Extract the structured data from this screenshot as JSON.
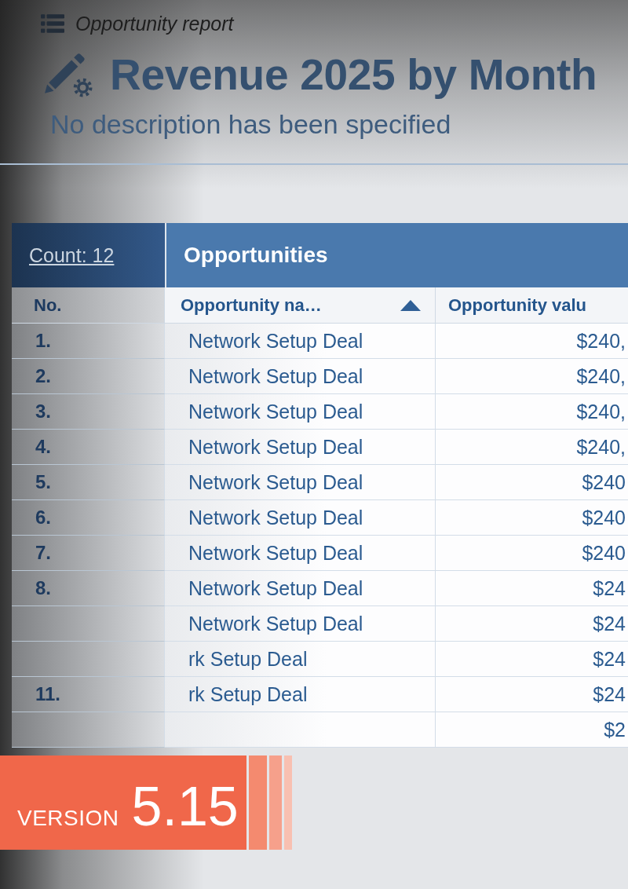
{
  "breadcrumb": {
    "label": "Opportunity report"
  },
  "header": {
    "title": "Revenue 2025 by Month",
    "description": "No description has been specified"
  },
  "table": {
    "count_link": "Count: 12",
    "group_header": "Opportunities",
    "columns": [
      {
        "label": "No.",
        "sorted": false
      },
      {
        "label": "Opportunity na…",
        "sorted": true
      },
      {
        "label": "Opportunity valu",
        "sorted": false
      }
    ],
    "rows": [
      {
        "no": "1.",
        "name": "Network Setup Deal",
        "value": "$240,"
      },
      {
        "no": "2.",
        "name": "Network Setup Deal",
        "value": "$240,"
      },
      {
        "no": "3.",
        "name": "Network Setup Deal",
        "value": "$240,"
      },
      {
        "no": "4.",
        "name": "Network Setup Deal",
        "value": "$240,"
      },
      {
        "no": "5.",
        "name": "Network Setup Deal",
        "value": "$240"
      },
      {
        "no": "6.",
        "name": "Network Setup Deal",
        "value": "$240"
      },
      {
        "no": "7.",
        "name": "Network Setup Deal",
        "value": "$240"
      },
      {
        "no": "8.",
        "name": "Network Setup Deal",
        "value": "$24"
      },
      {
        "name": "Network Setup Deal",
        "value": "$24"
      },
      {
        "name": "rk Setup Deal",
        "value": "$24"
      },
      {
        "no": "11.",
        "name": "rk Setup Deal",
        "value": "$24"
      },
      {
        "value": "$2"
      }
    ]
  },
  "badge": {
    "label": "VERSION",
    "version": "5.15"
  }
}
